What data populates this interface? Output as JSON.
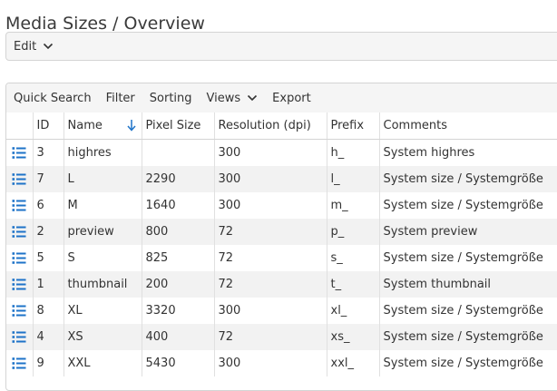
{
  "page": {
    "title": "Media Sizes / Overview"
  },
  "edit_menu": {
    "label": "Edit"
  },
  "toolbar": {
    "quick_search": "Quick Search",
    "filter": "Filter",
    "sorting": "Sorting",
    "views": "Views",
    "export": "Export"
  },
  "table": {
    "columns": {
      "id": "ID",
      "name": "Name",
      "pixel_size": "Pixel Size",
      "resolution": "Resolution (dpi)",
      "prefix": "Prefix",
      "comments": "Comments"
    },
    "sorted_column": "Name",
    "sort_direction": "ascending",
    "rows": [
      {
        "id": "3",
        "name": "highres",
        "pixel_size": "",
        "resolution": "300",
        "prefix": "h_",
        "comments": "System highres"
      },
      {
        "id": "7",
        "name": "L",
        "pixel_size": "2290",
        "resolution": "300",
        "prefix": "l_",
        "comments": "System size / Systemgröße"
      },
      {
        "id": "6",
        "name": "M",
        "pixel_size": "1640",
        "resolution": "300",
        "prefix": "m_",
        "comments": "System size / Systemgröße"
      },
      {
        "id": "2",
        "name": "preview",
        "pixel_size": "800",
        "resolution": "72",
        "prefix": "p_",
        "comments": "System preview"
      },
      {
        "id": "5",
        "name": "S",
        "pixel_size": "825",
        "resolution": "72",
        "prefix": "s_",
        "comments": "System size / Systemgröße"
      },
      {
        "id": "1",
        "name": "thumbnail",
        "pixel_size": "200",
        "resolution": "72",
        "prefix": "t_",
        "comments": "System thumbnail"
      },
      {
        "id": "8",
        "name": "XL",
        "pixel_size": "3320",
        "resolution": "300",
        "prefix": "xl_",
        "comments": "System size / Systemgröße"
      },
      {
        "id": "4",
        "name": "XS",
        "pixel_size": "400",
        "resolution": "72",
        "prefix": "xs_",
        "comments": "System size / Systemgröße"
      },
      {
        "id": "9",
        "name": "XXL",
        "pixel_size": "5430",
        "resolution": "300",
        "prefix": "xxl_",
        "comments": "System size / Systemgröße"
      }
    ]
  },
  "icons": {
    "row_action": "list-icon",
    "dropdown": "chevron-down-icon",
    "sort": "arrow-down-icon"
  },
  "colors": {
    "accent": "#1e73c8",
    "row_alt": "#f2f2f2",
    "toolbar_bg": "#f5f5f5"
  }
}
